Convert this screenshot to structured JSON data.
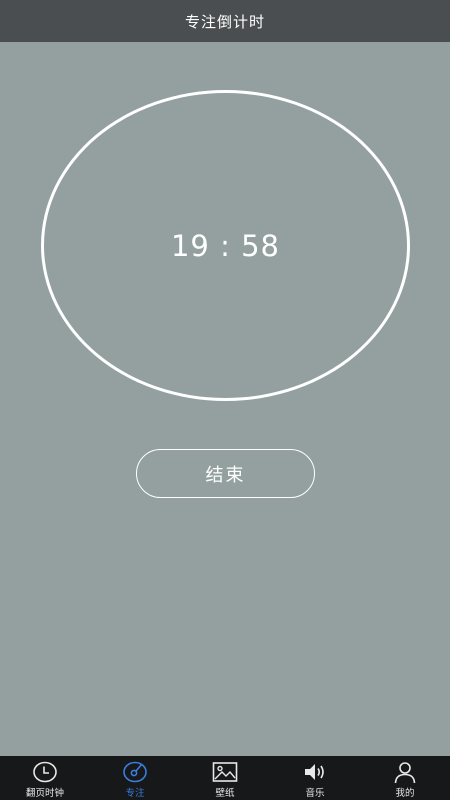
{
  "header": {
    "title": "专注倒计时"
  },
  "timer": {
    "display": "19 : 58"
  },
  "actions": {
    "end_label": "结束"
  },
  "tabbar": {
    "tabs": [
      {
        "label": "翻页时钟",
        "icon": "clock-icon",
        "active": false
      },
      {
        "label": "专注",
        "icon": "focus-dial-icon",
        "active": true
      },
      {
        "label": "壁纸",
        "icon": "image-icon",
        "active": false
      },
      {
        "label": "音乐",
        "icon": "speaker-icon",
        "active": false
      },
      {
        "label": "我的",
        "icon": "user-icon",
        "active": false
      }
    ]
  },
  "colors": {
    "background": "#93a09f",
    "header": "#4b4e51",
    "tabbar": "#161819",
    "accent": "#3c7de0",
    "foreground": "#ffffff"
  }
}
